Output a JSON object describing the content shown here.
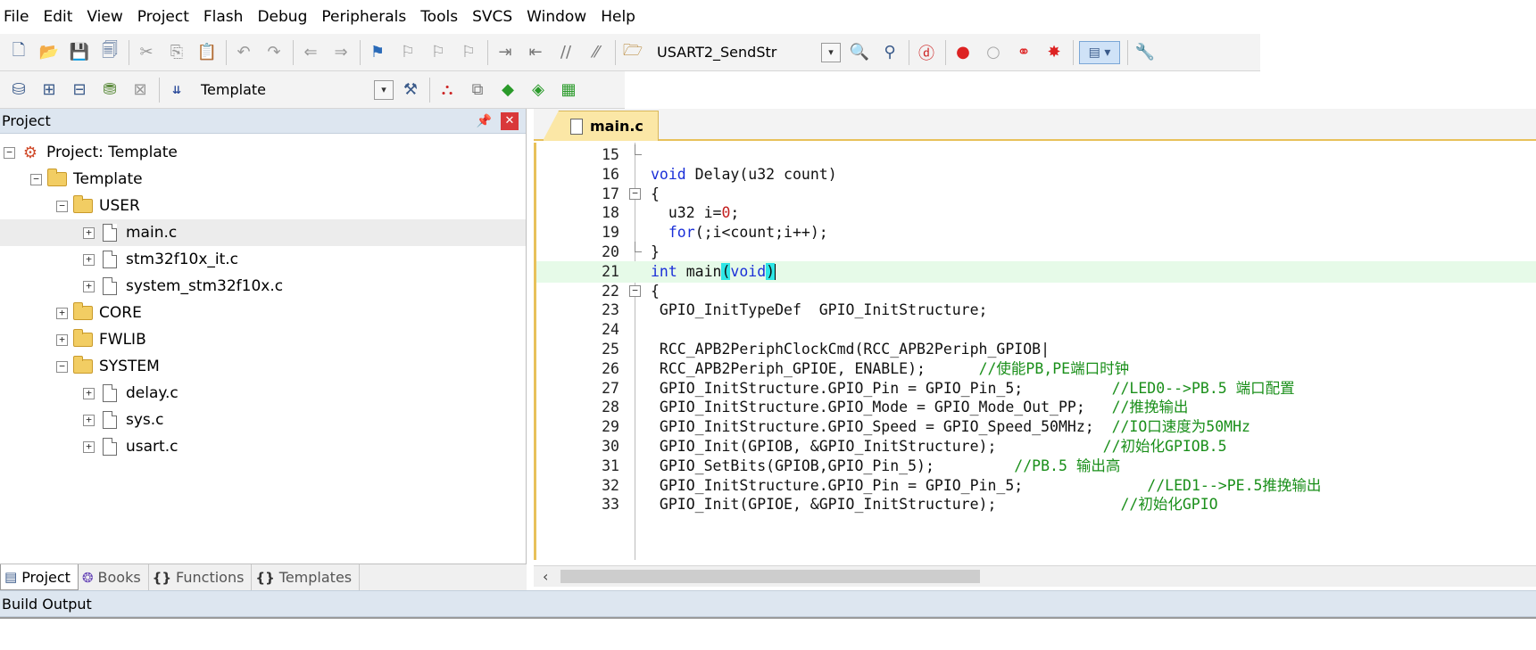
{
  "menu": [
    "File",
    "Edit",
    "View",
    "Project",
    "Flash",
    "Debug",
    "Peripherals",
    "Tools",
    "SVCS",
    "Window",
    "Help"
  ],
  "toolbar1": {
    "target_function": "USART2_SendStr"
  },
  "toolbar2": {
    "target": "Template"
  },
  "project_panel": {
    "title": "Project",
    "tree": [
      {
        "label": "Project: Template",
        "level": 0,
        "type": "project"
      },
      {
        "label": "Template",
        "level": 1,
        "type": "target"
      },
      {
        "label": "USER",
        "level": 2,
        "type": "folder"
      },
      {
        "label": "main.c",
        "level": 3,
        "type": "file",
        "selected": true
      },
      {
        "label": "stm32f10x_it.c",
        "level": 3,
        "type": "file"
      },
      {
        "label": "system_stm32f10x.c",
        "level": 3,
        "type": "file"
      },
      {
        "label": "CORE",
        "level": 2,
        "type": "folder"
      },
      {
        "label": "FWLIB",
        "level": 2,
        "type": "folder"
      },
      {
        "label": "SYSTEM",
        "level": 2,
        "type": "folder"
      },
      {
        "label": "delay.c",
        "level": 3,
        "type": "file"
      },
      {
        "label": "sys.c",
        "level": 3,
        "type": "file"
      },
      {
        "label": "usart.c",
        "level": 3,
        "type": "file"
      }
    ],
    "tabs": [
      "Project",
      "Books",
      "Functions",
      "Templates"
    ]
  },
  "editor": {
    "tab": "main.c",
    "lines": [
      {
        "n": "15",
        "code": ""
      },
      {
        "n": "16",
        "code": "void Delay(u32 count)"
      },
      {
        "n": "17",
        "code": "{"
      },
      {
        "n": "18",
        "code": "  u32 i=0;"
      },
      {
        "n": "19",
        "code": "  for(;i<count;i++);"
      },
      {
        "n": "20",
        "code": "}"
      },
      {
        "n": "21",
        "code": "int main(void)"
      },
      {
        "n": "22",
        "code": "{"
      },
      {
        "n": "23",
        "code": " GPIO_InitTypeDef  GPIO_InitStructure;"
      },
      {
        "n": "24",
        "code": ""
      },
      {
        "n": "25",
        "code": " RCC_APB2PeriphClockCmd(RCC_APB2Periph_GPIOB|"
      },
      {
        "n": "26",
        "code": " RCC_APB2Periph_GPIOE, ENABLE);      ",
        "comment": "//使能PB,PE端口时钟"
      },
      {
        "n": "27",
        "code": " GPIO_InitStructure.GPIO_Pin = GPIO_Pin_5;          ",
        "comment": "//LED0-->PB.5 端口配置"
      },
      {
        "n": "28",
        "code": " GPIO_InitStructure.GPIO_Mode = GPIO_Mode_Out_PP;   ",
        "comment": "//推挽输出"
      },
      {
        "n": "29",
        "code": " GPIO_InitStructure.GPIO_Speed = GPIO_Speed_50MHz;  ",
        "comment": "//IO口速度为50MHz"
      },
      {
        "n": "30",
        "code": " GPIO_Init(GPIOB, &GPIO_InitStructure);            ",
        "comment": "//初始化GPIOB.5"
      },
      {
        "n": "31",
        "code": " GPIO_SetBits(GPIOB,GPIO_Pin_5);         ",
        "comment": "//PB.5 输出高"
      },
      {
        "n": "32",
        "code": " GPIO_InitStructure.GPIO_Pin = GPIO_Pin_5;              ",
        "comment": "//LED1-->PE.5推挽输出"
      },
      {
        "n": "33",
        "code": " GPIO_Init(GPIOE, &GPIO_InitStructure);              ",
        "comment": "//初始化GPIO"
      }
    ]
  },
  "build_output": {
    "title": "Build Output"
  }
}
